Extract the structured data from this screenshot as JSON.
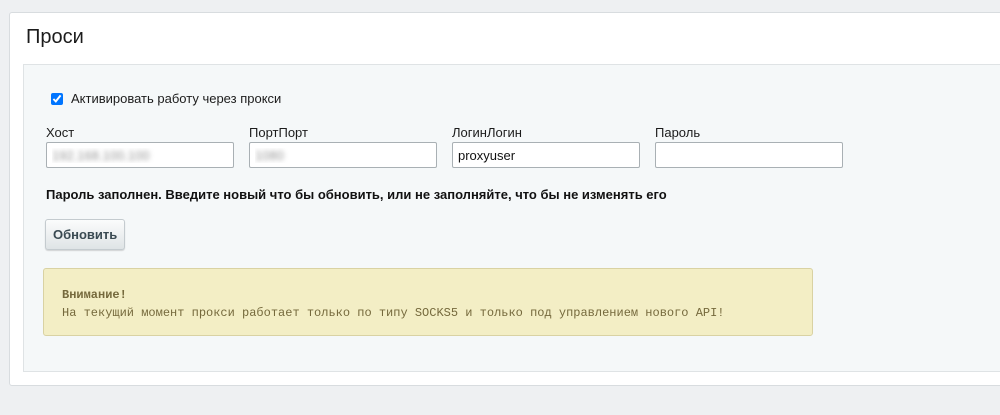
{
  "panel": {
    "title": "Проси"
  },
  "proxy_toggle": {
    "label": "Активировать работу через прокси",
    "checked": true
  },
  "fields": {
    "host": {
      "label": "Хост",
      "value": "192.168.100.100"
    },
    "port": {
      "label": "ПортПорт",
      "value": "1080"
    },
    "login": {
      "label": "ЛогинЛогин",
      "value": "proxyuser"
    },
    "password": {
      "label": "Пароль",
      "value": ""
    }
  },
  "password_notice": "Пароль заполнен. Введите новый что бы обновить, или не заполняйте, что бы не изменять его",
  "update_button": {
    "label": "Обновить"
  },
  "warning": {
    "title": "Внимание!",
    "text": "На текущий момент прокси работает только по типу SOCKS5 и только под управлением нового API!"
  }
}
